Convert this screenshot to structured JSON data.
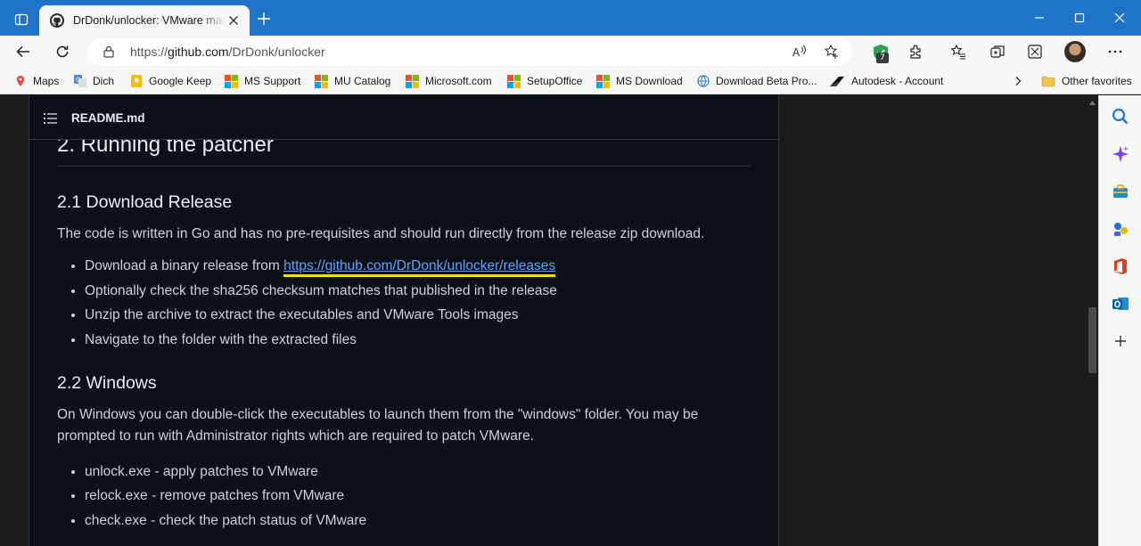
{
  "browser": {
    "tab_title": "DrDonk/unlocker: VMware macOS utilities",
    "url_prefix": "https://",
    "url_host": "github.com",
    "url_path": "/DrDonk/unlocker",
    "extension_badge": "7",
    "accent_color": "#1f74c8"
  },
  "favorites": [
    {
      "label": "Maps",
      "icon": "maps-pin-icon"
    },
    {
      "label": "Dich",
      "icon": "translate-icon"
    },
    {
      "label": "Google Keep",
      "icon": "keep-icon"
    },
    {
      "label": "MS Support",
      "icon": "microsoft-logo-icon"
    },
    {
      "label": "MU Catalog",
      "icon": "microsoft-logo-icon"
    },
    {
      "label": "Microsoft.com",
      "icon": "microsoft-logo-icon"
    },
    {
      "label": "SetupOffice",
      "icon": "microsoft-logo-icon"
    },
    {
      "label": "MS Download",
      "icon": "microsoft-logo-icon"
    },
    {
      "label": "Download Beta Pro...",
      "icon": "globe-icon"
    },
    {
      "label": "Autodesk - Account",
      "icon": "autodesk-icon"
    }
  ],
  "other_favorites": "Other favorites",
  "readme": {
    "file_name": "README.md",
    "h2": "2. Running the patcher",
    "sec1_title": "2.1 Download Release",
    "sec1_para": "The code is written in Go and has no pre-requisites and should run directly from the release zip download.",
    "sec1_items": [
      "Download a binary release from ",
      "Optionally check the sha256 checksum matches that published in the release",
      "Unzip the archive to extract the executables and VMware Tools images",
      "Navigate to the folder with the extracted files"
    ],
    "release_link": "https://github.com/DrDonk/unlocker/releases",
    "sec2_title": "2.2 Windows",
    "sec2_para": "On Windows you can double-click the executables to launch them from the \"windows\" folder. You may be prompted to run with Administrator rights which are required to patch VMware.",
    "sec2_items": [
      "unlock.exe - apply patches to VMware",
      "relock.exe - remove patches from VMware",
      "check.exe - check the patch status of VMware"
    ]
  }
}
